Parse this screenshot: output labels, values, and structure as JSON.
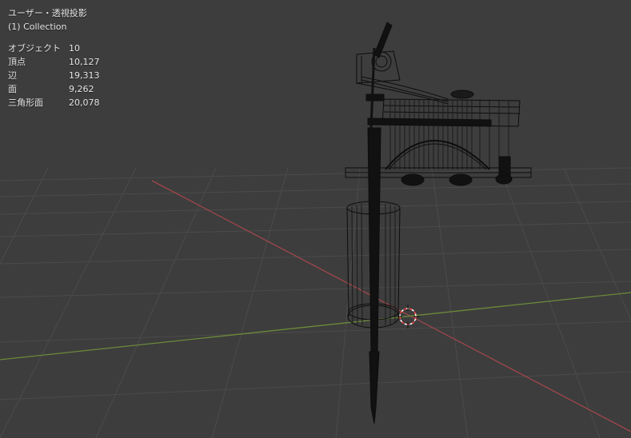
{
  "viewport": {
    "view_mode": "ユーザー・透視投影",
    "collection": "(1) Collection"
  },
  "statistics": [
    {
      "label": "オブジェクト",
      "value": "10"
    },
    {
      "label": "頂点",
      "value": "10,127"
    },
    {
      "label": "辺",
      "value": "19,313"
    },
    {
      "label": "面",
      "value": "9,262"
    },
    {
      "label": "三角形面",
      "value": "20,078"
    }
  ],
  "colors": {
    "background": "#3d3d3d",
    "grid": "#4a4a4a",
    "x_axis": "#a0464b",
    "y_axis": "#6b8a3a",
    "wire": "#0f0f0f",
    "cursor": "#ff4040"
  },
  "icons": [
    "3d-cursor-icon"
  ]
}
